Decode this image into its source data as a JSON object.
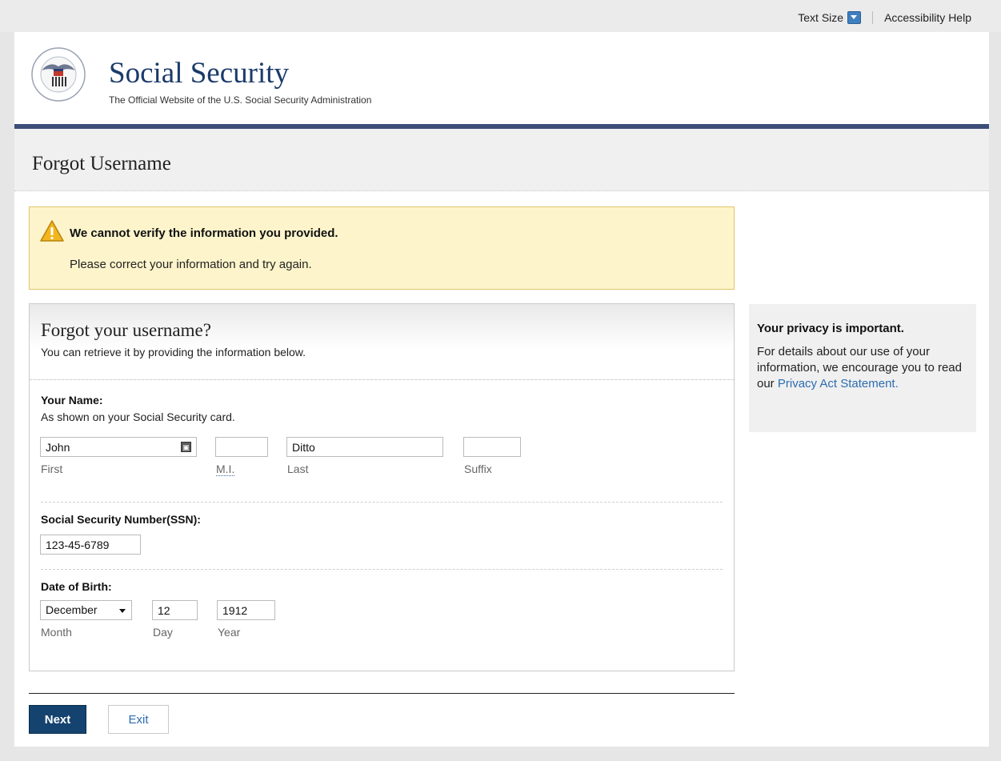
{
  "utility": {
    "text_size_label": "Text Size",
    "accessibility_help": "Accessibility Help"
  },
  "header": {
    "brand": "Social Security",
    "tagline": "The Official Website of the U.S. Social Security Administration",
    "seal_text": "SOCIAL SECURITY ADMINISTRATION USA"
  },
  "page": {
    "title": "Forgot Username"
  },
  "alert": {
    "title": "We cannot verify the information you provided.",
    "body": "Please correct your information and try again."
  },
  "form": {
    "title": "Forgot your username?",
    "subtitle": "You can retrieve it by providing the information below.",
    "name_section": {
      "label": "Your Name:",
      "hint": "As shown on your Social Security card.",
      "first_value": "John",
      "first_label": "First",
      "mi_value": "",
      "mi_label": "M.I.",
      "last_value": "Ditto",
      "last_label": "Last",
      "suffix_value": "",
      "suffix_label": "Suffix"
    },
    "ssn": {
      "label": "Social Security Number(SSN):",
      "value": "123-45-6789"
    },
    "dob": {
      "label": "Date of Birth:",
      "month_value": "December",
      "month_label": "Month",
      "day_value": "12",
      "day_label": "Day",
      "year_value": "1912",
      "year_label": "Year"
    }
  },
  "privacy": {
    "title": "Your privacy is important.",
    "body": "For details about our use of your information, we encourage you to read our ",
    "link": "Privacy Act Statement."
  },
  "actions": {
    "next": "Next",
    "exit": "Exit"
  },
  "colors": {
    "brand_blue": "#1b3a6b",
    "rule_blue": "#3d4e79",
    "next_button": "#14436f",
    "alert_bg": "#fdf4cb",
    "link": "#2b6cb0"
  }
}
